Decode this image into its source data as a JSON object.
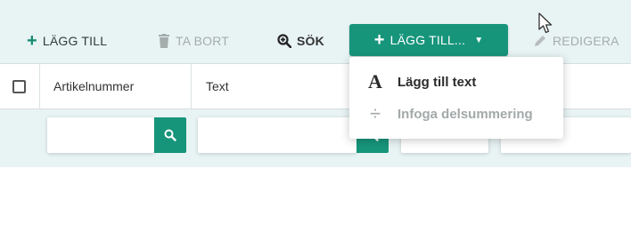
{
  "toolbar": {
    "add_label": "LÄGG TILL",
    "remove_label": "TA BORT",
    "search_label": "SÖK",
    "add_menu_label": "LÄGG TILL...",
    "edit_label": "REDIGERA"
  },
  "table": {
    "columns": [
      "Artikelnummer",
      "Text"
    ]
  },
  "filters": {
    "artikelnummer_value": "",
    "text_value": ""
  },
  "add_menu": {
    "items": [
      {
        "label": "Lägg till text",
        "icon": "text-A-icon",
        "enabled": true
      },
      {
        "label": "Infoga delsummering",
        "icon": "divide-icon",
        "enabled": false
      }
    ]
  },
  "colors": {
    "accent": "#17957b",
    "panel_bg": "#e8f3f4",
    "disabled": "#a5adad"
  }
}
